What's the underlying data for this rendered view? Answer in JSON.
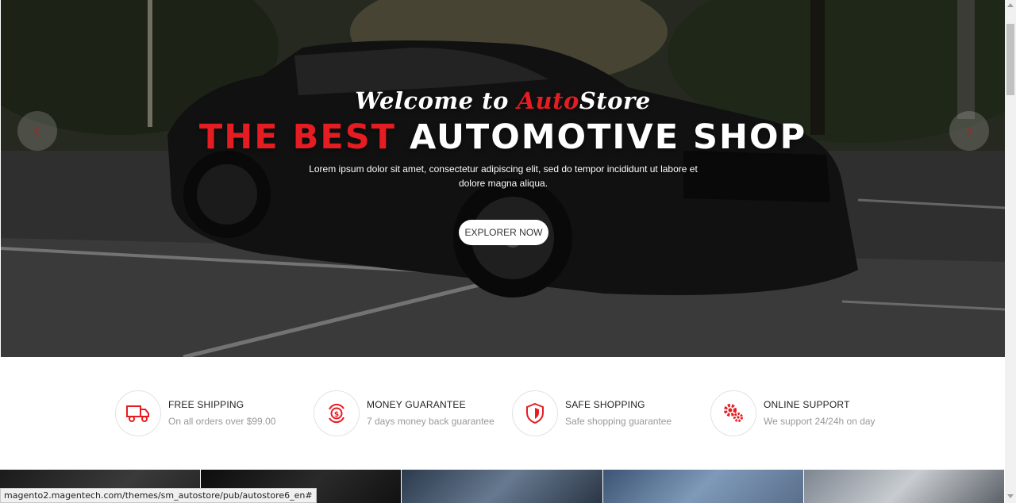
{
  "hero": {
    "welcome_prefix": "Welcome to ",
    "welcome_accent": "Auto",
    "welcome_suffix": "Store",
    "title_accent": "THE BEST",
    "title_rest": " AUTOMOTIVE SHOP",
    "text": "Lorem ipsum dolor sit amet, consectetur adipiscing elit, sed do tempor incididunt ut labore et dolore magna aliqua.",
    "button_label": "EXPLORER NOW",
    "prev_icon": "chevron-left-icon",
    "next_icon": "chevron-right-icon"
  },
  "features": [
    {
      "title": "FREE SHIPPING",
      "subtitle": "On all orders over $99.00",
      "icon": "truck-icon"
    },
    {
      "title": "MONEY GUARANTEE",
      "subtitle": "7 days money back guarantee",
      "icon": "money-back-icon"
    },
    {
      "title": "SAFE SHOPPING",
      "subtitle": "Safe shopping guarantee",
      "icon": "shield-icon"
    },
    {
      "title": "ONLINE SUPPORT",
      "subtitle": "We support 24/24h on day",
      "icon": "gears-icon"
    }
  ],
  "status_url": "magento2.magentech.com/themes/sm_autostore/pub/autostore6_en#",
  "colors": {
    "accent": "#e61c23",
    "text_dark": "#222222",
    "text_muted": "#999999"
  }
}
